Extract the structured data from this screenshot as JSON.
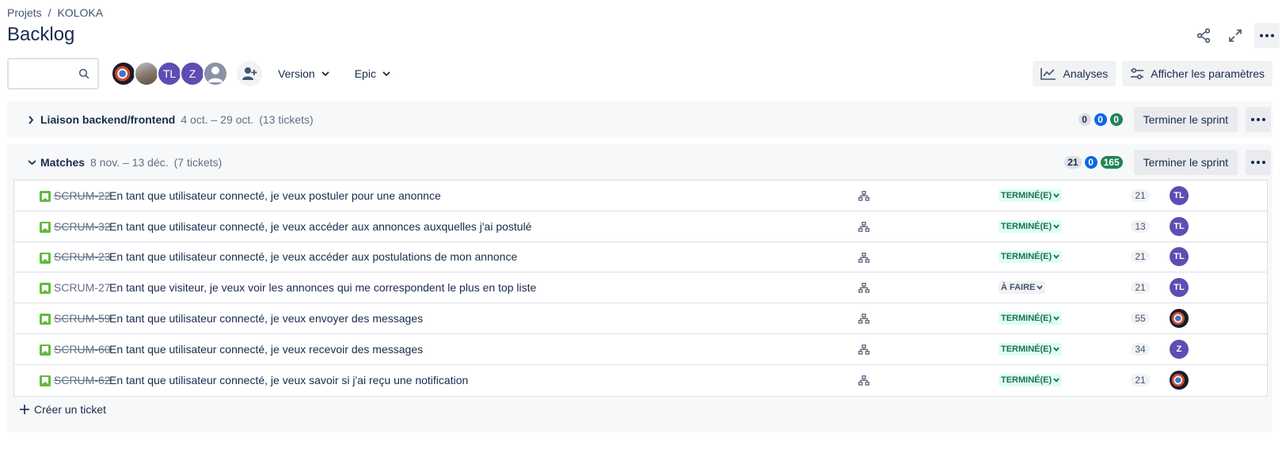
{
  "breadcrumb": {
    "projects": "Projets",
    "separator": "/",
    "project": "KOLOKA"
  },
  "page_title": "Backlog",
  "toolbar": {
    "search_placeholder": "",
    "avatars": [
      {
        "type": "photo1",
        "initials": ""
      },
      {
        "type": "photo2",
        "initials": ""
      },
      {
        "type": "purple",
        "initials": "TL"
      },
      {
        "type": "purple",
        "initials": "Z"
      },
      {
        "type": "gray",
        "initials": ""
      }
    ],
    "version_label": "Version",
    "epic_label": "Epic",
    "insights_label": "Analyses",
    "view_settings_label": "Afficher les paramètres"
  },
  "sprints": [
    {
      "name": "Liaison backend/frontend",
      "dates": "4 oct. – 29 oct.",
      "count": "(13 tickets)",
      "badges": {
        "todo": "0",
        "in_progress": "0",
        "done": "0"
      },
      "finish_label": "Terminer le sprint",
      "expanded": false
    },
    {
      "name": "Matches",
      "dates": "8 nov. – 13 déc.",
      "count": "(7 tickets)",
      "badges": {
        "todo": "21",
        "in_progress": "0",
        "done": "165"
      },
      "finish_label": "Terminer le sprint",
      "expanded": true,
      "issues": [
        {
          "key": "SCRUM-22",
          "summary": "En tant que utilisateur connecté, je veux postuler pour une anonnce",
          "status": "TERMINÉ(E)",
          "done": true,
          "points": "21",
          "assignee": "TL",
          "assignee_type": "purple"
        },
        {
          "key": "SCRUM-32",
          "summary": "En tant que utilisateur connecté, je veux accéder aux annonces auxquelles j'ai postulé",
          "status": "TERMINÉ(E)",
          "done": true,
          "points": "13",
          "assignee": "TL",
          "assignee_type": "purple"
        },
        {
          "key": "SCRUM-23",
          "summary": "En tant que utilisateur connecté, je veux accéder aux postulations de mon annonce",
          "status": "TERMINÉ(E)",
          "done": true,
          "points": "21",
          "assignee": "TL",
          "assignee_type": "purple"
        },
        {
          "key": "SCRUM-27",
          "summary": "En tant que visiteur, je veux voir les annonces qui me correspondent le plus en top liste",
          "status": "À FAIRE",
          "done": false,
          "points": "21",
          "assignee": "TL",
          "assignee_type": "purple"
        },
        {
          "key": "SCRUM-59",
          "summary": "En tant que utilisateur connecté, je veux envoyer des messages",
          "status": "TERMINÉ(E)",
          "done": true,
          "points": "55",
          "assignee": "",
          "assignee_type": "photo"
        },
        {
          "key": "SCRUM-60",
          "summary": "En tant que utilisateur connecté, je veux recevoir des messages",
          "status": "TERMINÉ(E)",
          "done": true,
          "points": "34",
          "assignee": "Z",
          "assignee_type": "purple"
        },
        {
          "key": "SCRUM-62",
          "summary": "En tant que utilisateur connecté, je veux savoir si j'ai reçu une notification",
          "status": "TERMINÉ(E)",
          "done": true,
          "points": "21",
          "assignee": "",
          "assignee_type": "photo"
        }
      ]
    }
  ],
  "create_ticket_label": "Créer un ticket",
  "colors": {
    "done_status_bg": "#dcfff1",
    "done_status_text": "#216e4e",
    "story_icon": "#63ba3c",
    "avatar_purple": "#5e4db2",
    "badge_blue": "#0c66e4",
    "badge_green": "#1f845a"
  },
  "icons": [
    "search-icon",
    "share-icon",
    "expand-icon",
    "more-icon",
    "add-people-icon",
    "chevron-down-icon",
    "chevron-right-icon",
    "chart-icon",
    "settings-sliders-icon",
    "story-icon",
    "hierarchy-icon",
    "plus-icon"
  ]
}
